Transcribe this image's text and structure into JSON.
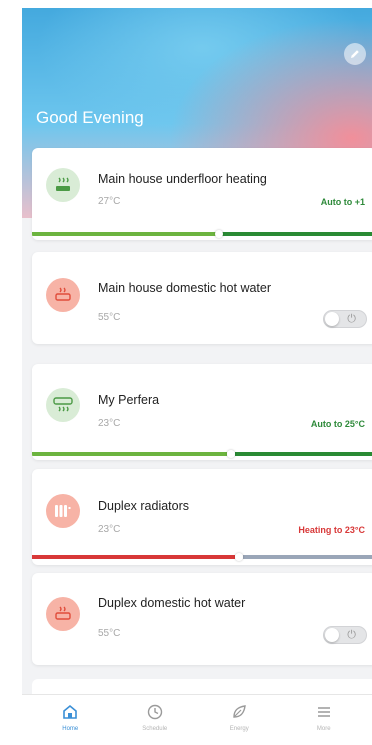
{
  "header": {
    "greeting": "Good Evening"
  },
  "devices": [
    {
      "title": "Main house underfloor heating",
      "temp": "27°C",
      "status": "Auto to +1",
      "status_color": "green",
      "icon": "underfloor-heating-icon",
      "control": "slider",
      "level": 0.53
    },
    {
      "title": "Main house domestic hot water",
      "temp": "55°C",
      "status": "",
      "icon": "hot-water-tank-icon",
      "control": "toggle",
      "toggle_on": false
    },
    {
      "title": "My Perfera",
      "temp": "23°C",
      "status": "Auto to 25°C",
      "status_color": "green",
      "icon": "air-conditioner-icon",
      "control": "slider",
      "level": 0.56
    },
    {
      "title": "Duplex radiators",
      "temp": "23°C",
      "status": "Heating to 23°C",
      "status_color": "red",
      "icon": "radiator-icon",
      "control": "slider",
      "level": 0.59
    },
    {
      "title": "Duplex domestic hot water",
      "temp": "55°C",
      "status": "",
      "icon": "hot-water-tank-icon",
      "control": "toggle",
      "toggle_on": false
    }
  ],
  "tabbar": {
    "items": [
      {
        "label": "Home",
        "icon": "home-icon",
        "active": true
      },
      {
        "label": "Schedule",
        "icon": "clock-icon",
        "active": false
      },
      {
        "label": "Energy",
        "icon": "leaf-icon",
        "active": false
      },
      {
        "label": "More",
        "icon": "menu-icon",
        "active": false
      }
    ]
  },
  "colors": {
    "accent": "#3a8fd6",
    "green_bar": "#6cb43f",
    "dark_green_bar": "#2a8a34",
    "red_bar": "#d83838",
    "grey_bar": "#9aa6b8"
  }
}
